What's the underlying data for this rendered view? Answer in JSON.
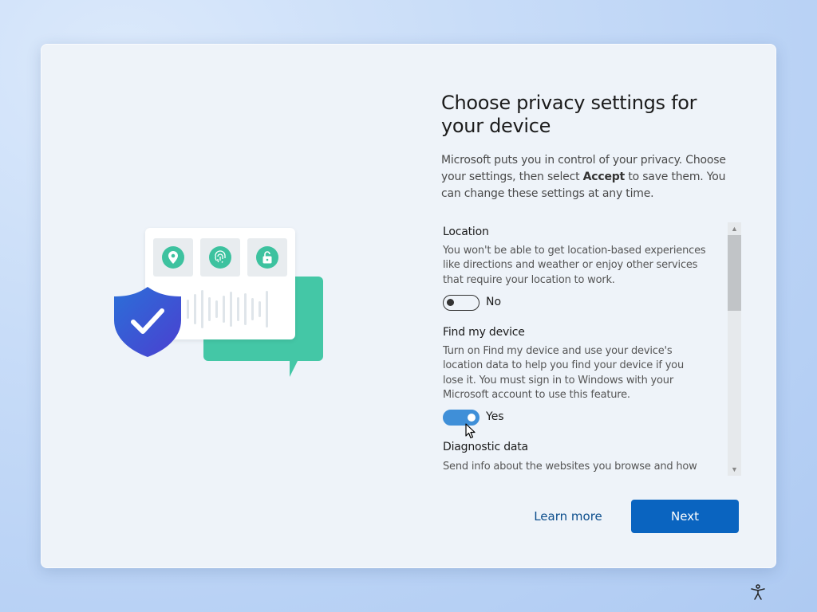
{
  "header": {
    "title": "Choose privacy settings for your device",
    "description_part1": "Microsoft puts you in control of your privacy. Choose your settings, then select ",
    "description_bold": "Accept",
    "description_part2": " to save them. You can change these settings at any time."
  },
  "settings": [
    {
      "title": "Location",
      "description": "You won't be able to get location-based experiences like directions and weather or enjoy other services that require your location to work.",
      "state": "off",
      "state_label": "No"
    },
    {
      "title": "Find my device",
      "description": "Turn on Find my device and use your device's location data to help you find your device if you lose it. You must sign in to Windows with your Microsoft account to use this feature.",
      "state": "on",
      "state_label": "Yes"
    },
    {
      "title": "Diagnostic data",
      "description": "Send info about the websites you browse and how"
    }
  ],
  "buttons": {
    "learn_more": "Learn more",
    "next": "Next"
  },
  "colors": {
    "accent": "#0a64c0",
    "toggle_on": "#3f8fd8",
    "illustration_green": "#44c7a6",
    "shield_blue": "#3a56d4"
  },
  "icons": {
    "tiles": [
      "location-pin-icon",
      "fingerprint-icon",
      "lock-icon"
    ],
    "shield": "shield-check-icon",
    "accessibility": "accessibility-icon"
  }
}
